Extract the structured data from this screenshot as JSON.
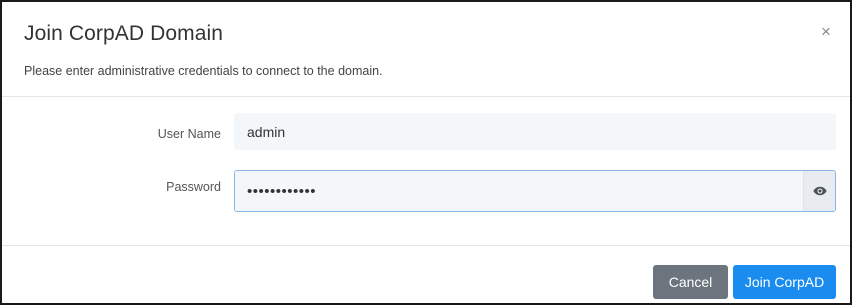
{
  "dialog": {
    "title": "Join CorpAD Domain",
    "subtitle": "Please enter administrative credentials to connect to the domain.",
    "close_label": "×"
  },
  "form": {
    "username_label": "User Name",
    "username_value": "admin",
    "password_label": "Password",
    "password_value": "••••••••••••",
    "password_toggle_icon": "eye-icon"
  },
  "footer": {
    "cancel_label": "Cancel",
    "join_label": "Join CorpAD"
  },
  "colors": {
    "primary": "#1a8cf0",
    "secondary": "#6c757d",
    "focus_border": "#88b6e8",
    "input_bg": "#f4f7fa"
  }
}
